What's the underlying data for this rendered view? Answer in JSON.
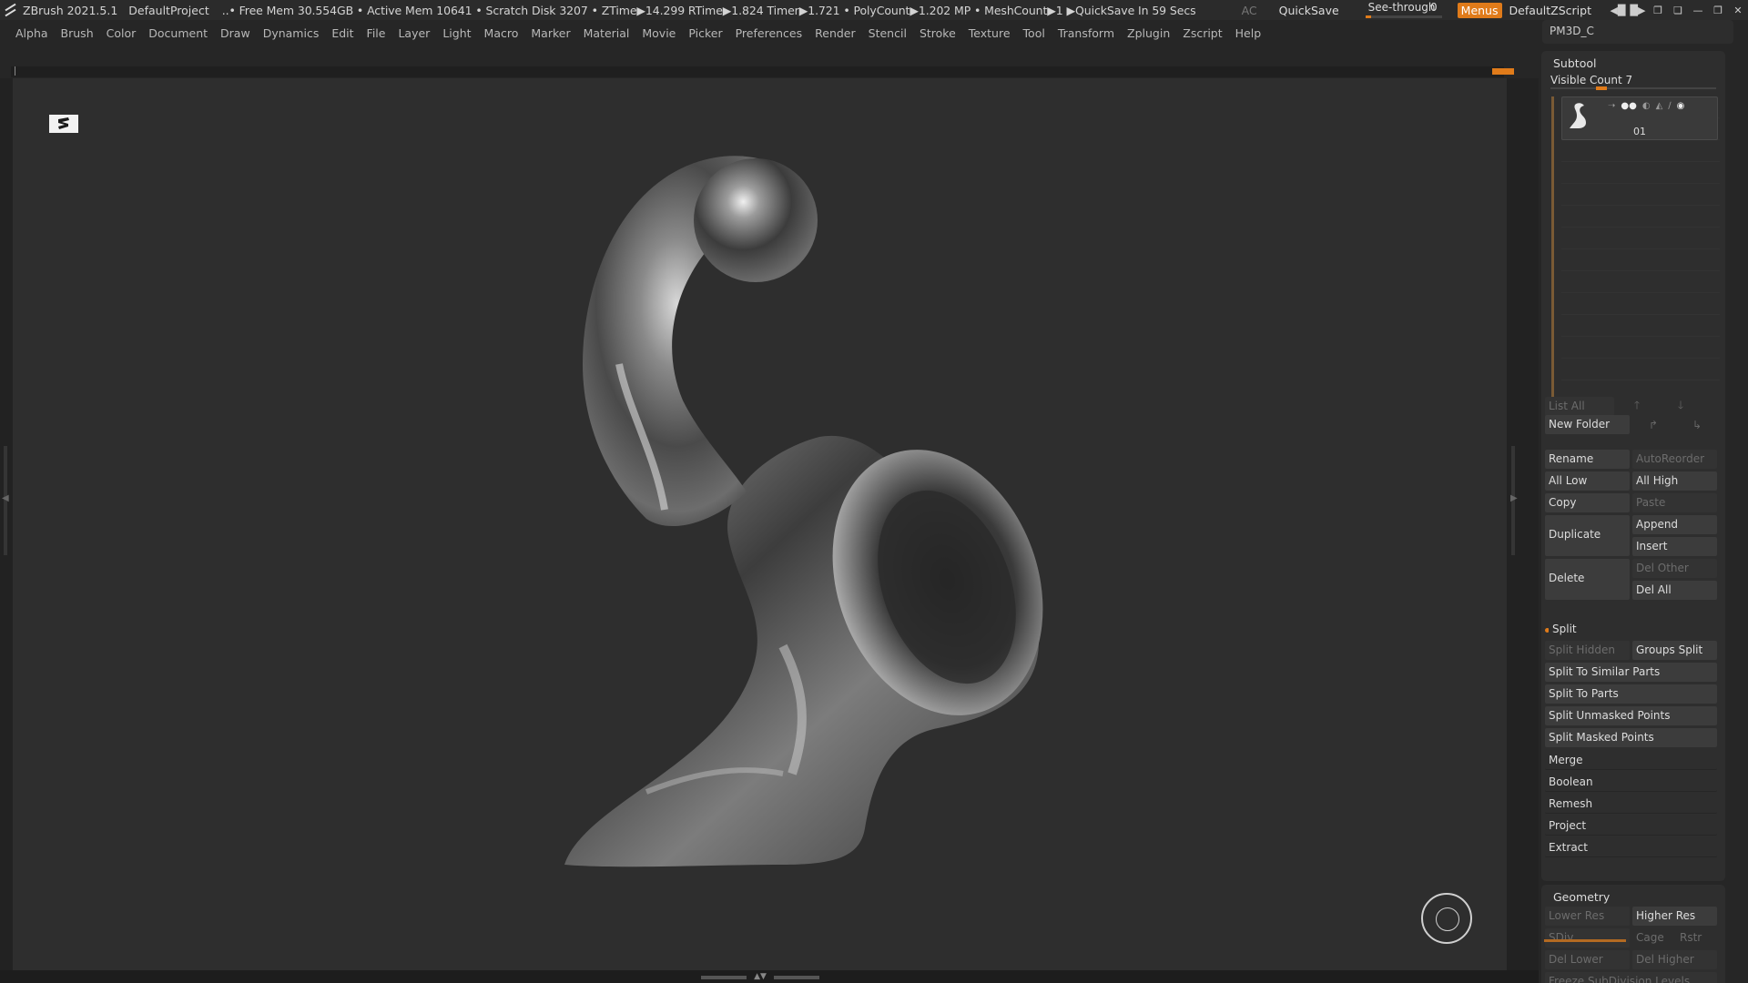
{
  "titlebar": {
    "app_name": "ZBrush 2021.5.1",
    "project": "DefaultProject",
    "stats": "..• Free Mem 30.554GB • Active Mem 10641 • Scratch Disk 3207 •  ZTime▶14.299 RTime▶1.824 Timer▶1.721 • PolyCount▶1.202 MP  • MeshCount▶1  ▶QuickSave In 59 Secs",
    "ac": "AC",
    "quicksave": "QuickSave",
    "see_through_label": "See-through",
    "see_through_value": "0",
    "see_through_fraction": 0.05,
    "menus_label": "Menus",
    "script_label": "DefaultZScript"
  },
  "menubar": {
    "items": [
      "Alpha",
      "Brush",
      "Color",
      "Document",
      "Draw",
      "Dynamics",
      "Edit",
      "File",
      "Layer",
      "Light",
      "Macro",
      "Marker",
      "Material",
      "Movie",
      "Picker",
      "Preferences",
      "Render",
      "Stencil",
      "Stroke",
      "Texture",
      "Tool",
      "Transform",
      "Zplugin",
      "Zscript",
      "Help"
    ]
  },
  "rightpanel": {
    "tool_name": "PM3D_C",
    "subtool": {
      "title": "Subtool",
      "visible_count": "Visible Count 7",
      "item_name": "01",
      "list_all": "List All",
      "new_folder": "New Folder",
      "rename": "Rename",
      "auto_reorder": "AutoReorder",
      "all_low": "All Low",
      "all_high": "All High",
      "copy": "Copy",
      "paste": "Paste",
      "duplicate": "Duplicate",
      "append": "Append",
      "insert": "Insert",
      "delete": "Delete",
      "del_other": "Del Other",
      "del_all": "Del All",
      "split": "Split",
      "split_hidden": "Split Hidden",
      "groups_split": "Groups Split",
      "split_similar": "Split To Similar Parts",
      "split_parts": "Split To Parts",
      "split_unmasked": "Split Unmasked Points",
      "split_masked": "Split Masked Points",
      "merge": "Merge",
      "boolean": "Boolean",
      "remesh": "Remesh",
      "project": "Project",
      "extract": "Extract"
    },
    "geometry": {
      "title": "Geometry",
      "lower_res": "Lower Res",
      "higher_res": "Higher Res",
      "sdiv": "SDiv",
      "cage": "Cage",
      "rstr": "Rstr",
      "del_lower": "Del Lower",
      "del_higher": "Del Higher",
      "freeze": "Freeze SubDivision Levels"
    }
  },
  "colors": {
    "accent": "#e07b1a",
    "background": "#262626",
    "canvas": "#2e2e2e"
  }
}
